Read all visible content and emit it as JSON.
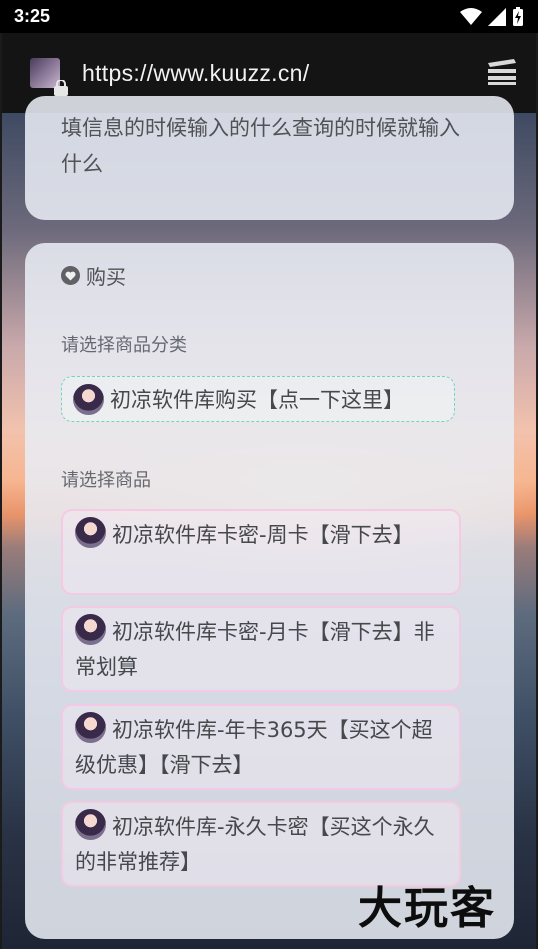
{
  "status_bar": {
    "time": "3:25"
  },
  "browser": {
    "url": "https://www.kuuzz.cn/"
  },
  "top_card": {
    "text": "填信息的时候输入的什么查询的时候就输入什么"
  },
  "purchase": {
    "title": "购买",
    "category_label": "请选择商品分类",
    "category_selected": "初凉软件库购买【点一下这里】",
    "product_label": "请选择商品",
    "products": [
      "初凉软件库卡密-周卡【滑下去】",
      "初凉软件库卡密-月卡【滑下去】非常划算",
      "初凉软件库-年卡365天【买这个超级优惠】【滑下去】",
      "初凉软件库-永久卡密【买这个永久的非常推荐】"
    ]
  },
  "watermark": "大玩客",
  "colors": {
    "category_border": "#6fd6bd",
    "product_border": "#f6c8e2"
  }
}
